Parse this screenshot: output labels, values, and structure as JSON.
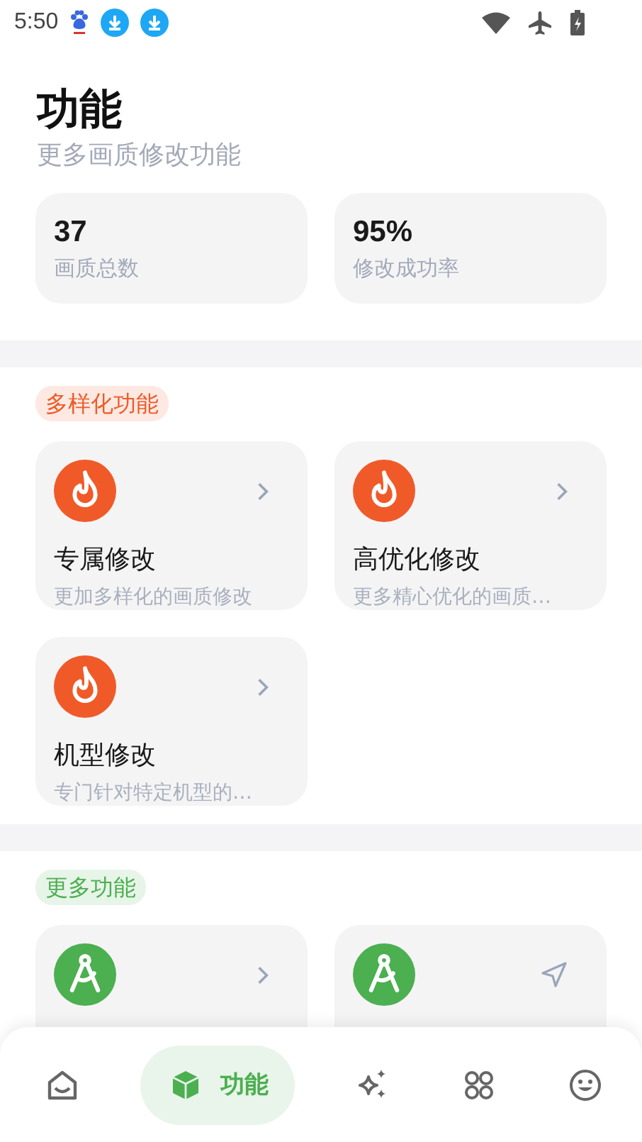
{
  "status_bar": {
    "time": "5:50"
  },
  "header": {
    "title": "功能",
    "subtitle": "更多画质修改功能"
  },
  "stats": [
    {
      "value": "37",
      "label": "画质总数"
    },
    {
      "value": "95%",
      "label": "修改成功率"
    }
  ],
  "sections": [
    {
      "tag": "多样化功能",
      "color": "#f05a28",
      "cards": [
        {
          "title": "专属修改",
          "description": "更加多样化的画质修改",
          "kind": "arrow"
        },
        {
          "title": "高优化修改",
          "description": "更多精心优化的画质…",
          "kind": "arrow"
        },
        {
          "title": "机型修改",
          "description": "专门针对特定机型的…",
          "kind": "arrow"
        }
      ]
    },
    {
      "tag": "更多功能",
      "color": "#4caf50",
      "cards": [
        {
          "kind": "arrow"
        },
        {
          "kind": "send"
        }
      ]
    }
  ],
  "nav": [
    {
      "selected": false
    },
    {
      "label": "功能",
      "selected": true
    },
    {
      "selected": false
    },
    {
      "selected": false
    },
    {
      "selected": false
    }
  ]
}
